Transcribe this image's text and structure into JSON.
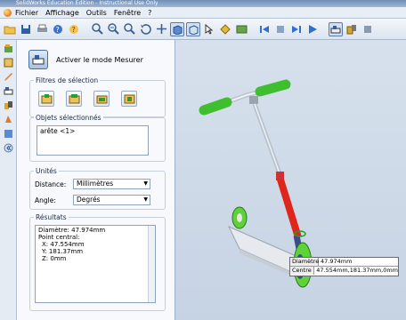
{
  "titlebar": {
    "text": "SolidWorks Education Edition - Instructional Use Only"
  },
  "menubar": {
    "items": [
      "Fichier",
      "Affichage",
      "Outils",
      "Fenêtre",
      "?"
    ]
  },
  "toolbar": {
    "icons": [
      "open-folder-icon",
      "save-icon",
      "print-icon",
      "question-icon",
      "help-icon",
      "zoom-fit-icon",
      "zoom-in-icon",
      "zoom-area-icon",
      "rotate-icon",
      "pan-icon",
      "shaded-view-icon",
      "wireframe-view-icon",
      "select-icon",
      "rebuild-icon",
      "options-icon",
      "first-frame-icon",
      "stop-icon",
      "step-forward-icon",
      "play-icon",
      "measure-icon",
      "mass-properties-icon",
      "section-icon"
    ]
  },
  "panel": {
    "measure_button_label": "Activer le mode Mesurer",
    "filters_title": "Filtres de sélection",
    "selected_title": "Objets sélectionnés",
    "selected_items": [
      "arête <1>"
    ],
    "units_title": "Unités",
    "distance_label": "Distance:",
    "distance_value": "Millimètres",
    "angle_label": "Angle:",
    "angle_value": "Degrés",
    "results_title": "Résultats",
    "results_lines": [
      "Diamètre: 47.974mm",
      "Point central:",
      "  X: 47.554mm",
      "  Y: 181.37mm",
      "  Z: 0mm"
    ]
  },
  "tooltip": {
    "rows": [
      {
        "key": "Diamètre",
        "value": "47.974mm"
      },
      {
        "key": "Centre",
        "value": "47.554mm,181.37mm,0mm"
      }
    ]
  },
  "colors": {
    "handle_grip": "#3fbf2f",
    "stem_red": "#e0261c",
    "deck": "#e6e9ee",
    "wheel": "#5fd23a"
  }
}
